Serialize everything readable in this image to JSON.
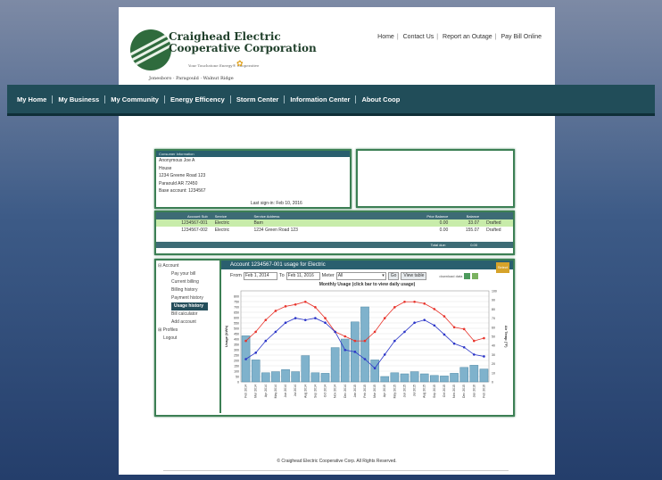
{
  "header": {
    "company_line1": "Craighead Electric",
    "company_line2": "Cooperative Corporation",
    "tagline": "Your Touchstone Energy® Cooperative",
    "towns": "Jonesboro · Paragould · Walnut Ridge",
    "links": [
      "Home",
      "Contact Us",
      "Report an Outage",
      "Pay Bill Online"
    ]
  },
  "nav": [
    "My Home",
    "My Business",
    "My Community",
    "Energy Efficency",
    "Storm Center",
    "Information Center",
    "About Coop"
  ],
  "consumer": {
    "header": "Consumer Information",
    "lines": [
      "Anonymous Joe A",
      "House",
      "1234 Greene Road 123",
      "Paraould AR 72450",
      "Base account: 1234567"
    ],
    "last_signin": "Last sign-in: Feb 10, 2016"
  },
  "accounts": {
    "headers": [
      "Account Sub",
      "Service",
      "Service Address",
      "Prior Balance",
      "Balance",
      ""
    ],
    "rows": [
      [
        "1234567-001",
        "Electric",
        "Barn",
        "0.00",
        "33.07",
        "Drafted"
      ],
      [
        "1234567-002",
        "Electric",
        "1234 Green Road 123",
        "0.00",
        "155.07",
        "Drafted"
      ]
    ],
    "total_label": "Total due:",
    "total_value": "0.00"
  },
  "sidebar": {
    "account": "Account",
    "items": [
      "Pay your bill",
      "Current billing",
      "Billing history",
      "Payment history",
      "Usage history",
      "Bill calculator",
      "Add account"
    ],
    "active_index": 4,
    "profiles": "Profiles",
    "logout": "Logout"
  },
  "usage": {
    "title": "Account 1234567-001 usage for Electric",
    "select_btn": "Select",
    "from_label": "From",
    "from_value": "Feb 1, 2014",
    "to_label": "To",
    "to_value": "Feb 11, 2016",
    "meter_label": "Meter",
    "meter_value": "All",
    "go": "Go",
    "view_table": "View table",
    "download": "download data"
  },
  "chart_data": {
    "type": "bar",
    "title": "Monthly Usage (click bar to view daily usage)",
    "ylabel": "Usage (kWh)",
    "y2label": "Air Temp (°F)",
    "ylim": [
      0,
      850
    ],
    "y_ticks": [
      0,
      50,
      100,
      150,
      200,
      250,
      300,
      350,
      400,
      450,
      500,
      550,
      600,
      650,
      700,
      750,
      800
    ],
    "y2lim": [
      0,
      100
    ],
    "y2_ticks": [
      0,
      10,
      20,
      30,
      40,
      50,
      60,
      70,
      80,
      90,
      100
    ],
    "categories": [
      "Feb 2014",
      "Mar 2014",
      "Apr 2014",
      "May 2014",
      "Jun 2014",
      "Jul 2014",
      "Aug 2014",
      "Sep 2014",
      "Oct 2014",
      "Nov 2014",
      "Dec 2014",
      "Jan 2015",
      "Feb 2015",
      "Mar 2015",
      "Apr 2015",
      "May 2015",
      "Jun 2015",
      "Jul 2015",
      "Aug 2015",
      "Sep 2015",
      "Oct 2015",
      "Nov 2015",
      "Dec 2015",
      "Jan 2016",
      "Feb 2016"
    ],
    "values": [
      430,
      205,
      85,
      95,
      115,
      95,
      245,
      85,
      80,
      320,
      400,
      560,
      700,
      205,
      50,
      85,
      75,
      95,
      75,
      60,
      55,
      80,
      135,
      155,
      120
    ],
    "series": [
      {
        "name": "High",
        "color": "#e8342c",
        "values": [
          45,
          55,
          68,
          78,
          83,
          85,
          88,
          82,
          70,
          55,
          50,
          45,
          45,
          55,
          70,
          82,
          88,
          88,
          86,
          80,
          72,
          60,
          58,
          45,
          48
        ]
      },
      {
        "name": "Low",
        "color": "#2b35c8",
        "values": [
          25,
          32,
          45,
          55,
          65,
          70,
          68,
          70,
          65,
          55,
          35,
          33,
          25,
          15,
          30,
          45,
          55,
          65,
          68,
          62,
          52,
          42,
          38,
          30,
          28
        ]
      }
    ],
    "bar_color": "#7fb2cc"
  },
  "footer": "© Craighead Electric Cooperative Corp. All Rights Reserved."
}
